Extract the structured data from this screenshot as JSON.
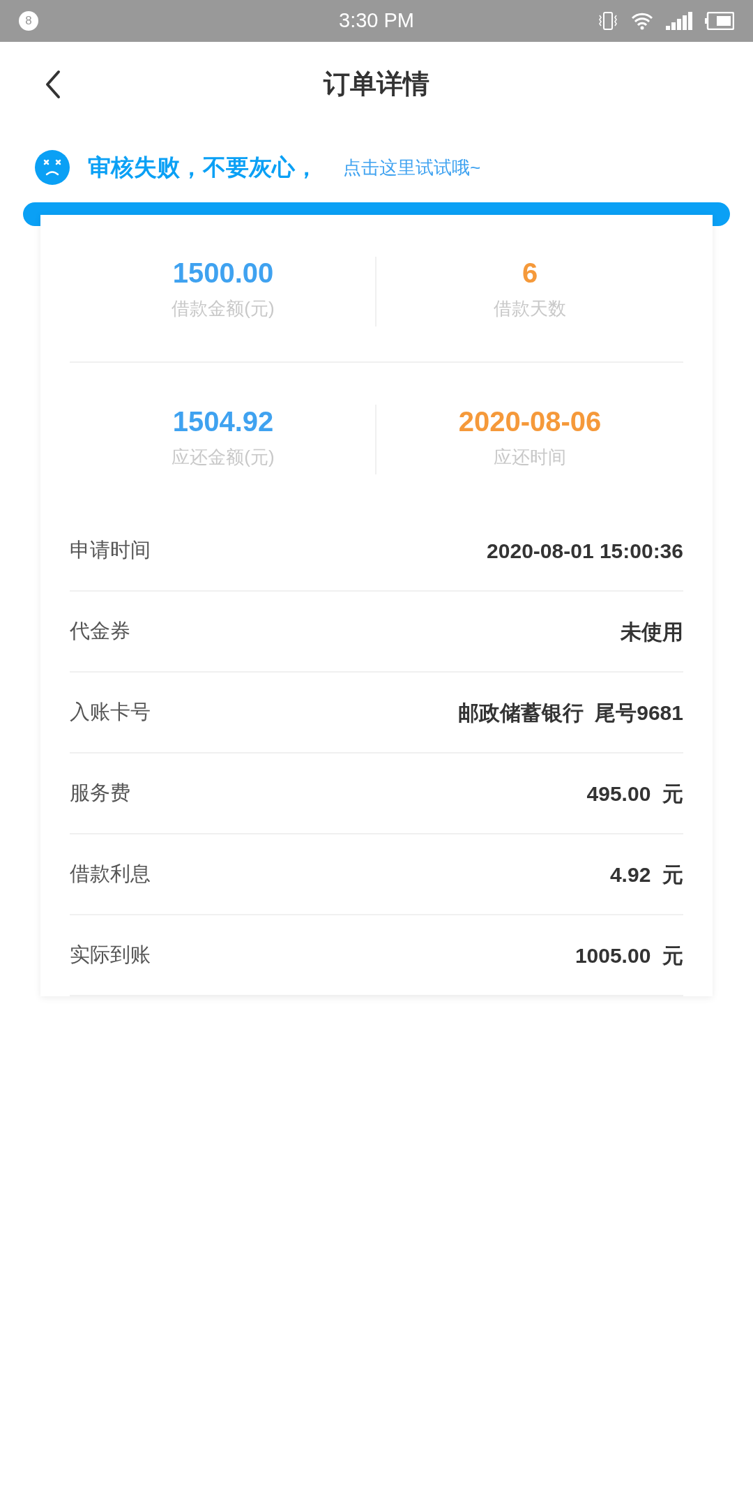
{
  "status_bar": {
    "notification_count": "8",
    "time": "3:30 PM"
  },
  "header": {
    "title": "订单详情"
  },
  "notice": {
    "message": "审核失败，不要灰心，",
    "link": "点击这里试试哦~"
  },
  "stats": [
    {
      "value": "1500.00",
      "label": "借款金额(元)",
      "color": "#3fa2f0"
    },
    {
      "value": "6",
      "label": "借款天数",
      "color": "#f5993a"
    },
    {
      "value": "1504.92",
      "label": "应还金额(元)",
      "color": "#3fa2f0"
    },
    {
      "value": "2020-08-06",
      "label": "应还时间",
      "color": "#f5993a"
    }
  ],
  "details": [
    {
      "label": "申请时间",
      "value": "2020-08-01 15:00:36"
    },
    {
      "label": "代金券",
      "value": "未使用"
    },
    {
      "label": "入账卡号",
      "value": "邮政储蓄银行  尾号9681"
    },
    {
      "label": "服务费",
      "value": "495.00  元"
    },
    {
      "label": "借款利息",
      "value": "4.92  元"
    },
    {
      "label": "实际到账",
      "value": "1005.00  元"
    }
  ]
}
